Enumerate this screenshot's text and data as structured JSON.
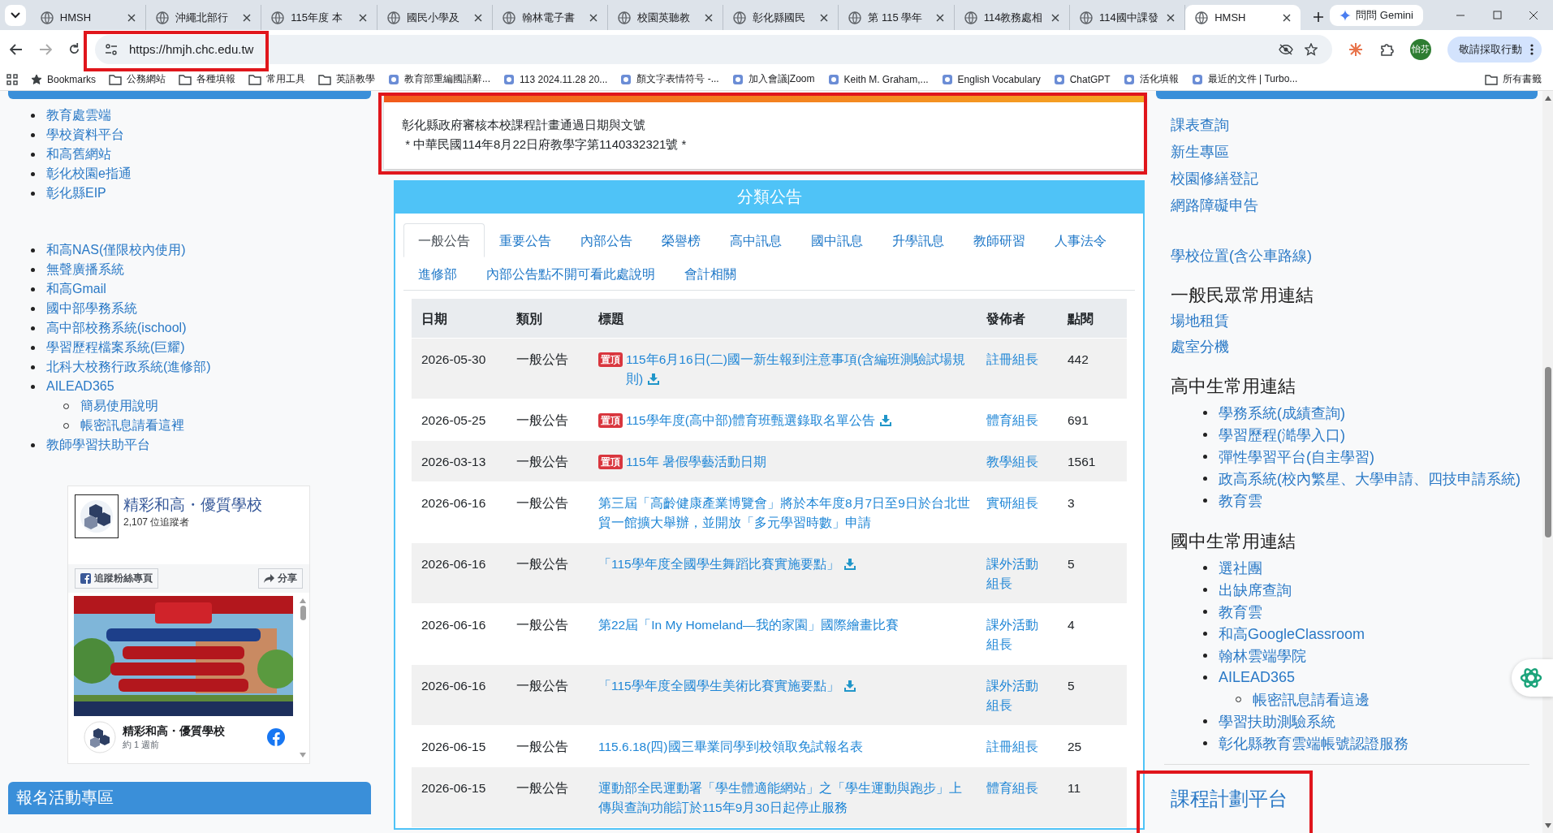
{
  "browser": {
    "tabs": [
      {
        "title": "HMSH",
        "selected": false
      },
      {
        "title": "沖繩北部行",
        "selected": false
      },
      {
        "title": "115年度 本",
        "selected": false
      },
      {
        "title": "國民小學及",
        "selected": false
      },
      {
        "title": "翰林電子書",
        "selected": false
      },
      {
        "title": "校園英聽教",
        "selected": false
      },
      {
        "title": "彰化縣國民",
        "selected": false
      },
      {
        "title": "第 115 學年",
        "selected": false
      },
      {
        "title": "114教務處相",
        "selected": false
      },
      {
        "title": "114國中課發",
        "selected": false
      },
      {
        "title": "HMSH",
        "selected": true
      }
    ],
    "gemini_button": "問問 Gemini",
    "url": "https://hmjh.chc.edu.tw",
    "profile": "怡芬",
    "action_button": "敬請採取行動",
    "bookmarks": [
      {
        "kind": "star",
        "label": "Bookmarks"
      },
      {
        "kind": "folder",
        "label": "公務網站"
      },
      {
        "kind": "folder",
        "label": "各種填報"
      },
      {
        "kind": "folder",
        "label": "常用工具"
      },
      {
        "kind": "folder",
        "label": "英語教學"
      },
      {
        "kind": "site",
        "label": "教育部重編國語辭..."
      },
      {
        "kind": "site",
        "label": "113 2024.11.28 20..."
      },
      {
        "kind": "site",
        "label": "顏文字表情符号 -..."
      },
      {
        "kind": "site",
        "label": "加入會議|Zoom"
      },
      {
        "kind": "site",
        "label": "Keith M. Graham,..."
      },
      {
        "kind": "site",
        "label": "English Vocabulary"
      },
      {
        "kind": "site",
        "label": "ChatGPT"
      },
      {
        "kind": "site",
        "label": "活化填報"
      },
      {
        "kind": "site",
        "label": "最近的文件 | Turbo..."
      }
    ],
    "all_bookmarks": "所有書籤"
  },
  "left_sidebar": {
    "link_groups": [
      [
        {
          "label": "教育處雲端"
        },
        {
          "label": "學校資料平台"
        },
        {
          "label": "和高舊網站"
        },
        {
          "label": "彰化校園e指通"
        },
        {
          "label": "彰化縣EIP"
        }
      ],
      [
        {
          "label": "和高NAS(僅限校內使用)"
        },
        {
          "label": "無聲廣播系統"
        },
        {
          "label": "和高Gmail"
        },
        {
          "label": "國中部學務系統"
        },
        {
          "label": "高中部校務系統(ischool)"
        },
        {
          "label": "學習歷程檔案系統(巨耀)"
        },
        {
          "label": "北科大校務行政系統(進修部)"
        },
        {
          "label": "AILEAD365",
          "children": [
            {
              "label": "簡易使用說明"
            },
            {
              "label": "帳密訊息請看這裡"
            }
          ]
        },
        {
          "label": "教師學習扶助平台"
        }
      ]
    ],
    "facebook_widget": {
      "page_name": "精彩和高・優質學校",
      "followers": "2,107 位追蹤者",
      "follow_button": "追蹤粉絲專頁",
      "share_button": "分享",
      "post": {
        "kind": "picture",
        "author": "精彩和高・優質學校",
        "time": "約 1 週前"
      }
    },
    "section_header": "報名活動專區"
  },
  "notice": {
    "lines": [
      "彰化縣政府審核本校課程計畫通過日期與文號",
      " * 中華民國114年8月22日府教學字第1140332321號 *"
    ]
  },
  "announcements": {
    "title": "分類公告",
    "tabs": [
      {
        "label": "一般公告",
        "selected": true
      },
      {
        "label": "重要公告",
        "selected": false
      },
      {
        "label": "內部公告",
        "selected": false
      },
      {
        "label": "榮譽榜",
        "selected": false
      },
      {
        "label": "高中訊息",
        "selected": false
      },
      {
        "label": "國中訊息",
        "selected": false
      },
      {
        "label": "升學訊息",
        "selected": false
      },
      {
        "label": "教師研習",
        "selected": false
      },
      {
        "label": "人事法令",
        "selected": false
      },
      {
        "label": "進修部",
        "selected": false
      },
      {
        "label": "內部公告點不開可看此處說明",
        "selected": false
      },
      {
        "label": "會計相關",
        "selected": false
      }
    ],
    "table": {
      "columns": [
        "日期",
        "類別",
        "標題",
        "發佈者",
        "點閱"
      ],
      "rows": [
        {
          "date": "2026-05-30",
          "category": "一般公告",
          "pinned": true,
          "pin_label": "置頂",
          "title": "115年6月16日(二)國一新生報到注意事項(含編班測驗試場規則)",
          "attachment": true,
          "publisher": "註冊組長",
          "views": "442"
        },
        {
          "date": "2026-05-25",
          "category": "一般公告",
          "pinned": true,
          "pin_label": "置頂",
          "title": "115學年度(高中部)體育班甄選錄取名單公告",
          "attachment": true,
          "publisher": "體育組長",
          "views": "691"
        },
        {
          "date": "2026-03-13",
          "category": "一般公告",
          "pinned": true,
          "pin_label": "置頂",
          "title": "115年 暑假學藝活動日期",
          "attachment": false,
          "publisher": "教學組長",
          "views": "1561"
        },
        {
          "date": "2026-06-16",
          "category": "一般公告",
          "pinned": false,
          "title": "第三屆「高齡健康產業博覽會」將於本年度8月7日至9日於台北世貿一館擴大舉辦，並開放「多元學習時數」申請",
          "attachment": false,
          "publisher": "實研組長",
          "views": "3"
        },
        {
          "date": "2026-06-16",
          "category": "一般公告",
          "pinned": false,
          "title": "「115學年度全國學生舞蹈比賽實施要點」",
          "attachment": true,
          "publisher": "課外活動組長",
          "views": "5"
        },
        {
          "date": "2026-06-16",
          "category": "一般公告",
          "pinned": false,
          "title": "第22屆「In My Homeland—我的家園」國際繪畫比賽",
          "attachment": false,
          "publisher": "課外活動組長",
          "views": "4"
        },
        {
          "date": "2026-06-16",
          "category": "一般公告",
          "pinned": false,
          "title": "「115學年度全國學生美術比賽實施要點」",
          "attachment": true,
          "publisher": "課外活動組長",
          "views": "5"
        },
        {
          "date": "2026-06-15",
          "category": "一般公告",
          "pinned": false,
          "title": "115.6.18(四)國三畢業同學到校領取免試報名表",
          "attachment": false,
          "publisher": "註冊組長",
          "views": "25"
        },
        {
          "date": "2026-06-15",
          "category": "一般公告",
          "pinned": false,
          "title": "運動部全民運動署「學生體適能網站」之「學生運動與跑步」上傳與查詢功能訂於115年9月30日起停止服務",
          "attachment": false,
          "publisher": "體育組長",
          "views": "11"
        }
      ]
    }
  },
  "right_sidebar": {
    "links": [
      {
        "label": "課表查詢"
      },
      {
        "label": "新生專區"
      },
      {
        "label": "校園修繕登記"
      },
      {
        "label": "網路障礙申告"
      }
    ],
    "location_link": "學校位置(含公車路線)",
    "sections": [
      {
        "kind": "plain",
        "heading": "一般民眾常用連結",
        "links": [
          {
            "label": "場地租賃"
          },
          {
            "label": "處室分機"
          }
        ]
      },
      {
        "kind": "bulleted",
        "heading": "高中生常用連結",
        "links": [
          {
            "label": "學務系統(成績查詢)"
          },
          {
            "label": "學習歷程(澔學入口)"
          },
          {
            "label": "彈性學習平台(自主學習)"
          },
          {
            "label": "政高系統(校內繁星、大學申請、四技申請系統)"
          },
          {
            "label": "教育雲"
          }
        ]
      },
      {
        "kind": "bulleted",
        "heading": "國中生常用連結",
        "links": [
          {
            "label": "選社團"
          },
          {
            "label": "出缺席查詢"
          },
          {
            "label": "教育雲"
          },
          {
            "label": "和高GoogleClassroom"
          },
          {
            "label": "翰林雲端學院"
          },
          {
            "label": "AILEAD365",
            "children": [
              {
                "label": "帳密訊息請看這邊"
              }
            ]
          },
          {
            "label": "學習扶助測驗系統"
          },
          {
            "label": "彰化縣教育雲端帳號認證服務"
          }
        ]
      }
    ],
    "platform_link": "課程計劃平台"
  }
}
